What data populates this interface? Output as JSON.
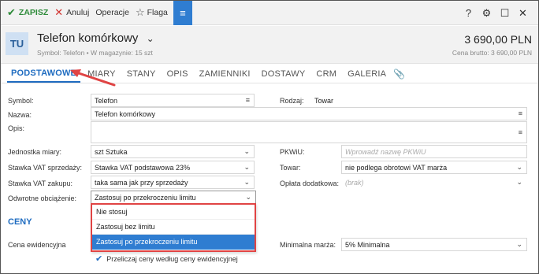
{
  "toolbar": {
    "save_label": "ZAPISZ",
    "cancel_label": "Anuluj",
    "operations_label": "Operacje",
    "flag_label": "Flaga",
    "help_glyph": "?",
    "menu_glyph": "≡"
  },
  "header": {
    "avatar": "TU",
    "name": "Telefon komórkowy",
    "meta": "Symbol: Telefon  •  W magazynie: 15 szt",
    "price": "3 690,00 PLN",
    "gross": "Cena brutto: 3 690,00 PLN"
  },
  "tabs": [
    {
      "label": "PODSTAWOWE",
      "active": true
    },
    {
      "label": "MIARY"
    },
    {
      "label": "STANY"
    },
    {
      "label": "OPIS"
    },
    {
      "label": "ZAMIENNIKI"
    },
    {
      "label": "DOSTAWY"
    },
    {
      "label": "CRM"
    },
    {
      "label": "GALERIA"
    }
  ],
  "form": {
    "symbol_label": "Symbol:",
    "symbol_value": "Telefon",
    "rodzaj_label": "Rodzaj:",
    "rodzaj_value": "Towar",
    "nazwa_label": "Nazwa:",
    "nazwa_value": "Telefon komórkowy",
    "opis_label": "Opis:",
    "opis_value": "",
    "jm_label": "Jednostka miary:",
    "jm_value": "szt  Sztuka",
    "pkwiu_label": "PKWiU:",
    "pkwiu_placeholder": "Wprowadź nazwę PKWiU",
    "vat_sale_label": "Stawka VAT sprzedaży:",
    "vat_sale_value": "Stawka VAT podstawowa 23%",
    "towar_label": "Towar:",
    "towar_value": "nie podlega obrotowi VAT marża",
    "vat_buy_label": "Stawka VAT zakupu:",
    "vat_buy_value": "taka sama jak przy sprzedaży",
    "oplata_label": "Opłata dodatkowa:",
    "oplata_value": "(brak)",
    "odwrotne_label": "Odwrotne obciążenie:",
    "odwrotne_value": "Zastosuj po przekroczeniu limitu"
  },
  "dropdown": {
    "options": [
      "Nie stosuj",
      "Zastosuj bez limitu",
      "Zastosuj po przekroczeniu limitu"
    ],
    "selected_index": 2
  },
  "ceny": {
    "section_label": "CENY",
    "cena_ewid_label": "Cena ewidencyjna",
    "min_marza_label": "Minimalna marża:",
    "min_marza_value": "5%  Minimalna",
    "recalc_label": "Przeliczaj ceny według ceny ewidencyjnej",
    "recalc_checked": true
  },
  "colors": {
    "accent": "#1f6cc0",
    "save_green": "#2e8b3a",
    "cancel_red": "#d0312d",
    "annotation_red": "#e04444"
  }
}
